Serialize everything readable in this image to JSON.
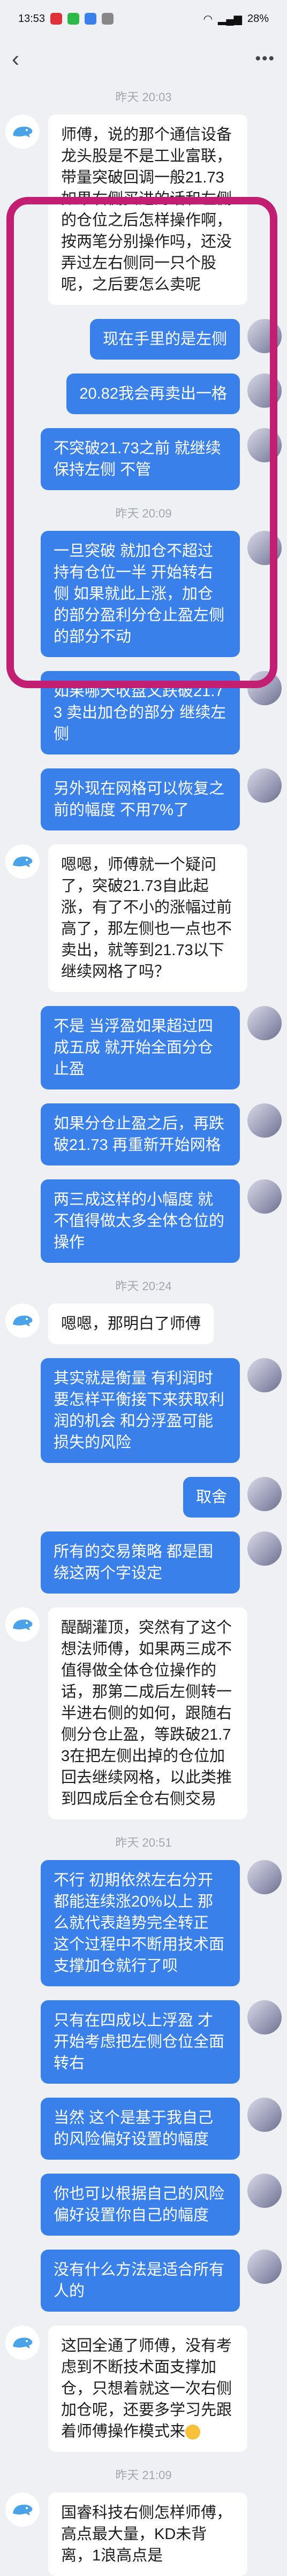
{
  "status": {
    "time": "13:53",
    "battery": "28%"
  },
  "nav": {
    "back": "‹",
    "more": "•••"
  },
  "messages": [
    {
      "type": "ts",
      "text": "昨天 20:03"
    },
    {
      "type": "left",
      "text": "师傅，说的那个通信设备龙头股是不是工业富联，带量突破回调一般21.73如果右侧买进的话和左侧的仓位之后怎样操作啊，按两笔分别操作吗，还没弄过左右侧同一只个股呢，之后要怎么卖呢"
    },
    {
      "type": "right",
      "text": "现在手里的是左侧"
    },
    {
      "type": "right",
      "text": "20.82我会再卖出一格"
    },
    {
      "type": "right",
      "text": "不突破21.73之前 就继续保持左侧 不管"
    },
    {
      "type": "ts",
      "text": "昨天 20:09"
    },
    {
      "type": "right",
      "text": "一旦突破 就加仓不超过持有仓位一半 开始转右侧 如果就此上涨，加仓的部分盈利分仓止盈左侧的部分不动"
    },
    {
      "type": "right",
      "text": "如果哪天收盘又跌破21.73 卖出加仓的部分 继续左侧"
    },
    {
      "type": "right",
      "text": "另外现在网格可以恢复之前的幅度 不用7%了"
    },
    {
      "type": "left",
      "text": "嗯嗯，师傅就一个疑问了，突破21.73自此起涨，有了不小的涨幅过前高了，那左侧也一点也不卖出，就等到21.73以下继续网格了吗？"
    },
    {
      "type": "right",
      "text": "不是 当浮盈如果超过四成五成 就开始全面分仓止盈"
    },
    {
      "type": "right",
      "text": "如果分仓止盈之后，再跌破21.73 再重新开始网格"
    },
    {
      "type": "right",
      "text": "两三成这样的小幅度 就不值得做太多全体仓位的操作"
    },
    {
      "type": "ts",
      "text": "昨天 20:24"
    },
    {
      "type": "left",
      "text": "嗯嗯，那明白了师傅"
    },
    {
      "type": "right",
      "text": "其实就是衡量 有利润时 要怎样平衡接下来获取利润的机会 和分浮盈可能损失的风险"
    },
    {
      "type": "right",
      "text": "取舍"
    },
    {
      "type": "right",
      "text": "所有的交易策略 都是围绕这两个字设定"
    },
    {
      "type": "left",
      "text": "醍醐灌顶，突然有了这个想法师傅，如果两三成不值得做全体仓位操作的话，那第二成后左侧转一半进右侧的如何，跟随右侧分仓止盈，等跌破21.73在把左侧出掉的仓位加回去继续网格，以此类推到四成后全仓右侧交易"
    },
    {
      "type": "ts",
      "text": "昨天 20:51"
    },
    {
      "type": "right",
      "text": "不行 初期依然左右分开 都能连续涨20%以上 那么就代表趋势完全转正 这个过程中不断用技术面支撑加仓就行了呗"
    },
    {
      "type": "right",
      "text": "只有在四成以上浮盈 才开始考虑把左侧仓位全面转右"
    },
    {
      "type": "right",
      "text": "当然 这个是基于我自己的风险偏好设置的幅度"
    },
    {
      "type": "right",
      "text": "你也可以根据自己的风险偏好设置你自己的幅度"
    },
    {
      "type": "right",
      "text": "没有什么方法是适合所有人的"
    },
    {
      "type": "left",
      "text": "这回全通了师傅，没有考虑到不断技术面支撑加仓，只想着就这一次右侧加仓呢，还要多学习先跟着师傅操作模式来",
      "emoji": true
    },
    {
      "type": "ts",
      "text": "昨天 21:09"
    },
    {
      "type": "left",
      "text": "国睿科技右侧怎样师傅，高点最大量，KD未背离，1浪高点是"
    }
  ],
  "colors": {
    "accent": "#3a80ea",
    "highlight": "#c21e72"
  }
}
